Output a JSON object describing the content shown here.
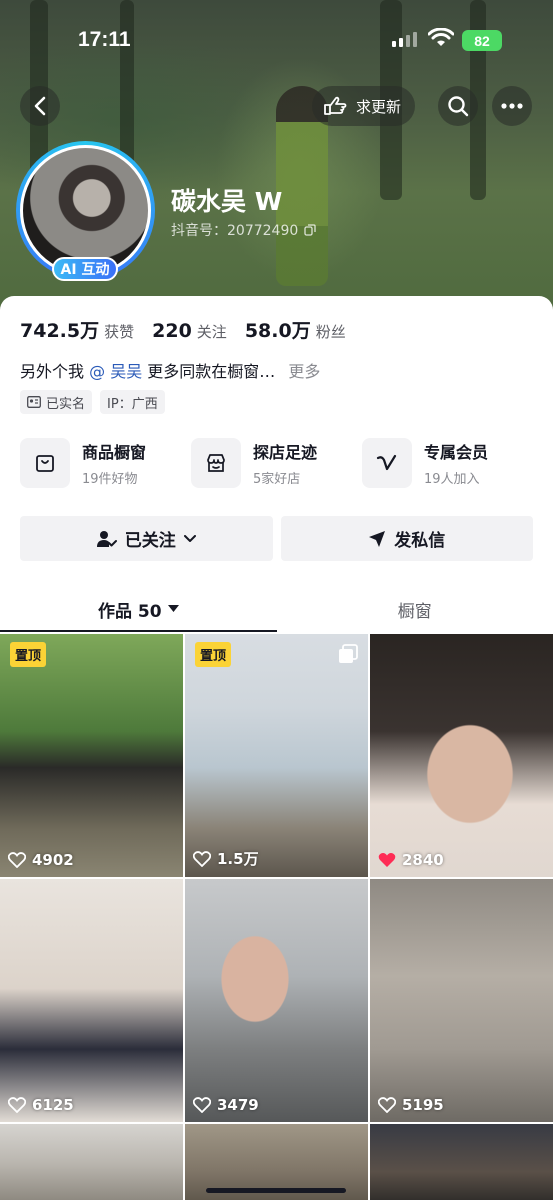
{
  "status_bar": {
    "time": "17:11",
    "battery": "82"
  },
  "header": {
    "request_update_label": "求更新",
    "nickname": "碳水吴 W",
    "douyin_id": "抖音号：20772490",
    "ai_badge": "AI 互动"
  },
  "stats": [
    {
      "value": "742.5万",
      "label": "获赞"
    },
    {
      "value": "220",
      "label": "关注"
    },
    {
      "value": "58.0万",
      "label": "粉丝"
    }
  ],
  "bio": {
    "prefix": "另外个我",
    "mention": "@ 吴吴",
    "suffix": "更多同款在橱窗…",
    "more": "更多"
  },
  "tags": {
    "verified": "已实名",
    "ip": "IP：广西"
  },
  "shortcuts": [
    {
      "title": "商品橱窗",
      "sub": "19件好物",
      "icon": "bag-icon"
    },
    {
      "title": "探店足迹",
      "sub": "5家好店",
      "icon": "store-icon"
    },
    {
      "title": "专属会员",
      "sub": "19人加入",
      "icon": "v-membership-icon"
    }
  ],
  "actions": {
    "followed": "已关注",
    "message": "发私信"
  },
  "tabs": {
    "works": "作品 50",
    "showcase": "橱窗"
  },
  "videos": [
    {
      "likes": "4902",
      "pinned": "置顶",
      "liked": false
    },
    {
      "likes": "1.5万",
      "pinned": "置顶",
      "liked": false,
      "multi": true
    },
    {
      "likes": "2840",
      "liked": true
    },
    {
      "likes": "6125",
      "liked": false
    },
    {
      "likes": "3479",
      "liked": false
    },
    {
      "likes": "5195",
      "liked": false
    }
  ],
  "colors": {
    "accent_blue": "#3a6ff7",
    "pin_yellow": "#fbd336",
    "heart_red": "#fe2c55",
    "battery_green": "#4cd964"
  }
}
